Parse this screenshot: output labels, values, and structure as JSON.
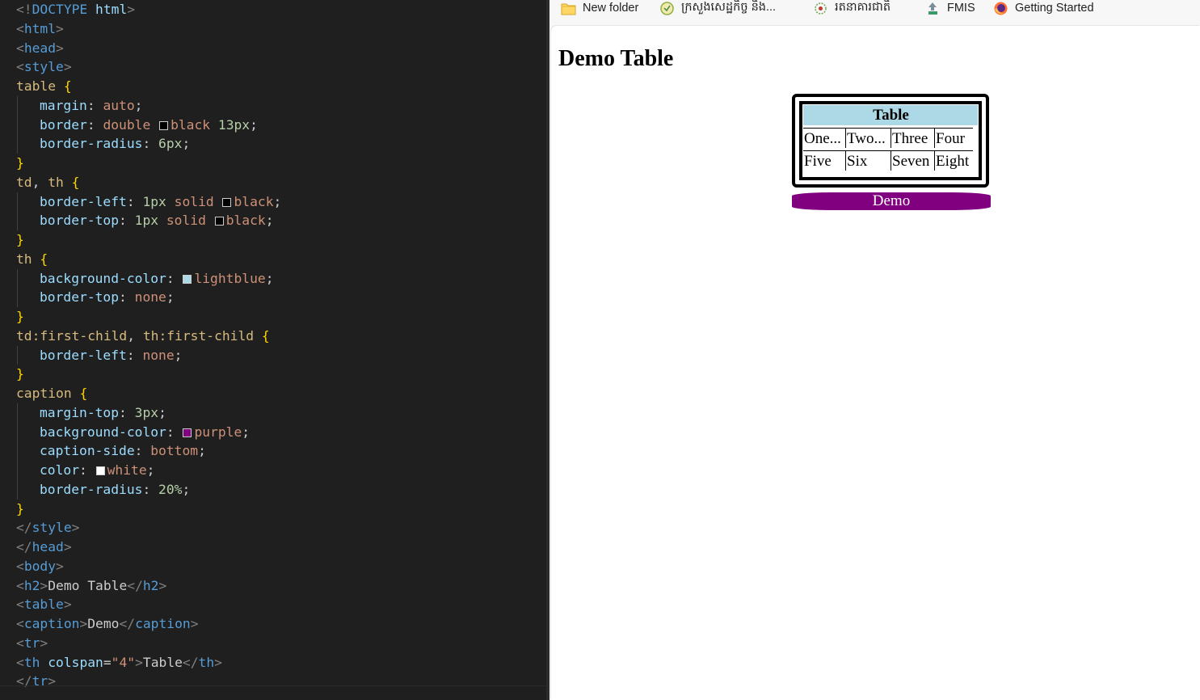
{
  "editor": {
    "lines": [
      {
        "indent": false,
        "tokens": [
          [
            "bracket",
            "<!"
          ],
          [
            "tag",
            "DOCTYPE"
          ],
          [
            "txt",
            " "
          ],
          [
            "attr",
            "html"
          ],
          [
            "bracket",
            ">"
          ]
        ]
      },
      {
        "indent": false,
        "tokens": [
          [
            "bracket",
            "<"
          ],
          [
            "tag",
            "html"
          ],
          [
            "bracket",
            ">"
          ]
        ]
      },
      {
        "indent": false,
        "tokens": [
          [
            "bracket",
            "<"
          ],
          [
            "tag",
            "head"
          ],
          [
            "bracket",
            ">"
          ]
        ]
      },
      {
        "indent": false,
        "tokens": [
          [
            "bracket",
            "<"
          ],
          [
            "tag",
            "style"
          ],
          [
            "bracket",
            ">"
          ]
        ]
      },
      {
        "indent": false,
        "tokens": [
          [
            "sel",
            "table"
          ],
          [
            "txt",
            " "
          ],
          [
            "brace",
            "{"
          ]
        ]
      },
      {
        "indent": true,
        "tokens": [
          [
            "prop",
            "margin"
          ],
          [
            "txt",
            ": "
          ],
          [
            "val",
            "auto"
          ],
          [
            "txt",
            ";"
          ]
        ]
      },
      {
        "indent": true,
        "tokens": [
          [
            "prop",
            "border"
          ],
          [
            "txt",
            ": "
          ],
          [
            "val",
            "double "
          ],
          [
            "swatch",
            "#000000"
          ],
          [
            "val",
            "black "
          ],
          [
            "num",
            "13px"
          ],
          [
            "txt",
            ";"
          ]
        ]
      },
      {
        "indent": true,
        "tokens": [
          [
            "prop",
            "border-radius"
          ],
          [
            "txt",
            ": "
          ],
          [
            "num",
            "6px"
          ],
          [
            "txt",
            ";"
          ]
        ]
      },
      {
        "indent": false,
        "tokens": [
          [
            "brace",
            "}"
          ]
        ]
      },
      {
        "indent": false,
        "tokens": [
          [
            "sel",
            "td"
          ],
          [
            "txt",
            ", "
          ],
          [
            "sel",
            "th"
          ],
          [
            "txt",
            " "
          ],
          [
            "brace",
            "{"
          ]
        ]
      },
      {
        "indent": true,
        "tokens": [
          [
            "prop",
            "border-left"
          ],
          [
            "txt",
            ": "
          ],
          [
            "num",
            "1px"
          ],
          [
            "val",
            " solid "
          ],
          [
            "swatch",
            "#000000"
          ],
          [
            "val",
            "black"
          ],
          [
            "txt",
            ";"
          ]
        ]
      },
      {
        "indent": true,
        "tokens": [
          [
            "prop",
            "border-top"
          ],
          [
            "txt",
            ": "
          ],
          [
            "num",
            "1px"
          ],
          [
            "val",
            " solid "
          ],
          [
            "swatch",
            "#000000"
          ],
          [
            "val",
            "black"
          ],
          [
            "txt",
            ";"
          ]
        ]
      },
      {
        "indent": false,
        "tokens": [
          [
            "brace",
            "}"
          ]
        ]
      },
      {
        "indent": false,
        "tokens": [
          [
            "sel",
            "th"
          ],
          [
            "txt",
            " "
          ],
          [
            "brace",
            "{"
          ]
        ]
      },
      {
        "indent": true,
        "tokens": [
          [
            "prop",
            "background-color"
          ],
          [
            "txt",
            ": "
          ],
          [
            "swatch",
            "#add8e6"
          ],
          [
            "val",
            "lightblue"
          ],
          [
            "txt",
            ";"
          ]
        ]
      },
      {
        "indent": true,
        "tokens": [
          [
            "prop",
            "border-top"
          ],
          [
            "txt",
            ": "
          ],
          [
            "val",
            "none"
          ],
          [
            "txt",
            ";"
          ]
        ]
      },
      {
        "indent": false,
        "tokens": [
          [
            "brace",
            "}"
          ]
        ]
      },
      {
        "indent": false,
        "tokens": [
          [
            "sel",
            "td:first-child"
          ],
          [
            "txt",
            ", "
          ],
          [
            "sel",
            "th:first-child"
          ],
          [
            "txt",
            " "
          ],
          [
            "brace",
            "{"
          ]
        ]
      },
      {
        "indent": true,
        "tokens": [
          [
            "prop",
            "border-left"
          ],
          [
            "txt",
            ": "
          ],
          [
            "val",
            "none"
          ],
          [
            "txt",
            ";"
          ]
        ]
      },
      {
        "indent": false,
        "tokens": [
          [
            "brace",
            "}"
          ]
        ]
      },
      {
        "indent": false,
        "tokens": [
          [
            "sel",
            "caption"
          ],
          [
            "txt",
            " "
          ],
          [
            "brace",
            "{"
          ]
        ]
      },
      {
        "indent": true,
        "tokens": [
          [
            "prop",
            "margin-top"
          ],
          [
            "txt",
            ": "
          ],
          [
            "num",
            "3px"
          ],
          [
            "txt",
            ";"
          ]
        ]
      },
      {
        "indent": true,
        "tokens": [
          [
            "prop",
            "background-color"
          ],
          [
            "txt",
            ": "
          ],
          [
            "swatch",
            "#800080"
          ],
          [
            "val",
            "purple"
          ],
          [
            "txt",
            ";"
          ]
        ]
      },
      {
        "indent": true,
        "tokens": [
          [
            "prop",
            "caption-side"
          ],
          [
            "txt",
            ": "
          ],
          [
            "val",
            "bottom"
          ],
          [
            "txt",
            ";"
          ]
        ]
      },
      {
        "indent": true,
        "tokens": [
          [
            "prop",
            "color"
          ],
          [
            "txt",
            ": "
          ],
          [
            "swatch",
            "#ffffff"
          ],
          [
            "val",
            "white"
          ],
          [
            "txt",
            ";"
          ]
        ]
      },
      {
        "indent": true,
        "tokens": [
          [
            "prop",
            "border-radius"
          ],
          [
            "txt",
            ": "
          ],
          [
            "num",
            "20%"
          ],
          [
            "txt",
            ";"
          ]
        ]
      },
      {
        "indent": false,
        "tokens": [
          [
            "brace",
            "}"
          ]
        ]
      },
      {
        "indent": false,
        "tokens": [
          [
            "bracket",
            "</"
          ],
          [
            "tag",
            "style"
          ],
          [
            "bracket",
            ">"
          ]
        ]
      },
      {
        "indent": false,
        "tokens": [
          [
            "bracket",
            "</"
          ],
          [
            "tag",
            "head"
          ],
          [
            "bracket",
            ">"
          ]
        ]
      },
      {
        "indent": false,
        "tokens": [
          [
            "bracket",
            "<"
          ],
          [
            "tag",
            "body"
          ],
          [
            "bracket",
            ">"
          ]
        ]
      },
      {
        "indent": false,
        "tokens": [
          [
            "bracket",
            "<"
          ],
          [
            "tag",
            "h2"
          ],
          [
            "bracket",
            ">"
          ],
          [
            "txt",
            "Demo Table"
          ],
          [
            "bracket",
            "</"
          ],
          [
            "tag",
            "h2"
          ],
          [
            "bracket",
            ">"
          ]
        ]
      },
      {
        "indent": false,
        "tokens": [
          [
            "bracket",
            "<"
          ],
          [
            "tag",
            "table"
          ],
          [
            "bracket",
            ">"
          ]
        ]
      },
      {
        "indent": false,
        "tokens": [
          [
            "bracket",
            "<"
          ],
          [
            "tag",
            "caption"
          ],
          [
            "bracket",
            ">"
          ],
          [
            "txt",
            "Demo"
          ],
          [
            "bracket",
            "</"
          ],
          [
            "tag",
            "caption"
          ],
          [
            "bracket",
            ">"
          ]
        ]
      },
      {
        "indent": false,
        "tokens": [
          [
            "bracket",
            "<"
          ],
          [
            "tag",
            "tr"
          ],
          [
            "bracket",
            ">"
          ]
        ]
      },
      {
        "indent": false,
        "tokens": [
          [
            "bracket",
            "<"
          ],
          [
            "tag",
            "th"
          ],
          [
            "txt",
            " "
          ],
          [
            "attr",
            "colspan"
          ],
          [
            "txt",
            "="
          ],
          [
            "str",
            "\"4\""
          ],
          [
            "bracket",
            ">"
          ],
          [
            "txt",
            "Table"
          ],
          [
            "bracket",
            "</"
          ],
          [
            "tag",
            "th"
          ],
          [
            "bracket",
            ">"
          ]
        ]
      },
      {
        "indent": false,
        "tokens": [
          [
            "bracket",
            "</"
          ],
          [
            "tag",
            "tr"
          ],
          [
            "bracket",
            ">"
          ]
        ]
      }
    ]
  },
  "bookmarks": [
    {
      "label": "New folder",
      "icon": "folder-icon"
    },
    {
      "label": "ក្រសួងសេដ្ឋកិច្ច និង...",
      "icon": "ministry-logo-icon"
    },
    {
      "label": "រតនាគារជាតិ",
      "icon": "treasury-logo-icon"
    },
    {
      "label": "FMIS",
      "icon": "fmis-logo-icon"
    },
    {
      "label": "Getting Started",
      "icon": "firefox-icon"
    }
  ],
  "page": {
    "heading": "Demo Table",
    "table": {
      "header": "Table",
      "rows": [
        [
          "One...",
          "Two...",
          "Three",
          "Four"
        ],
        [
          "Five",
          "Six",
          "Seven",
          "Eight"
        ]
      ],
      "caption": "Demo"
    }
  },
  "colors": {
    "editor_bg": "#1f1f1f",
    "header_bg": "lightblue",
    "caption_bg": "purple",
    "caption_text": "white"
  }
}
